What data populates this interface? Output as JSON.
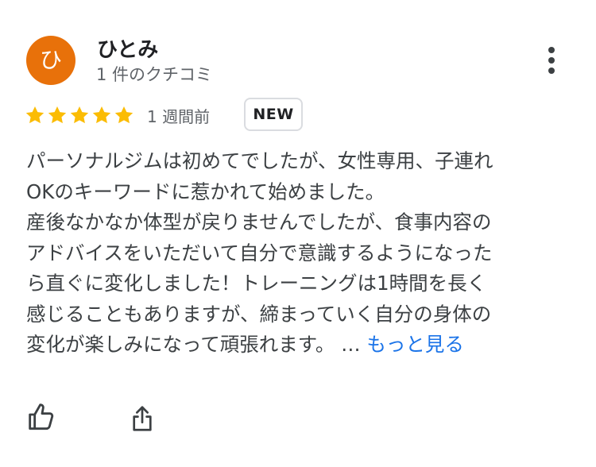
{
  "reviewer": {
    "avatar_letter": "ひ",
    "avatar_color": "#e8710a",
    "name": "ひとみ",
    "review_count": "1 件のクチコミ"
  },
  "rating": {
    "stars": 5,
    "max_stars": 5,
    "star_color": "#fbbc04"
  },
  "meta": {
    "date": "1 週間前",
    "badge": "NEW"
  },
  "review": {
    "lines": [
      "パーソナルジムは初めてでしたが、女性専用、子連れ",
      "OKのキーワードに惹かれて始めました。",
      "産後なかなか体型が戻りませんでしたが、食事内容の",
      "アドバイスをいただいて自分で意識するようになった",
      "ら直ぐに変化しました！トレーニングは1時間を長く",
      "感じることもありますが、締まっていく自分の身体の",
      "変化が楽しみになって頑張れます。 …"
    ],
    "read_more": "もっと見る",
    "link_color": "#1a73e8"
  },
  "actions": {
    "like_icon": "thumb-up-outline-icon",
    "share_icon": "share-icon",
    "more_icon": "more-vert-icon"
  }
}
